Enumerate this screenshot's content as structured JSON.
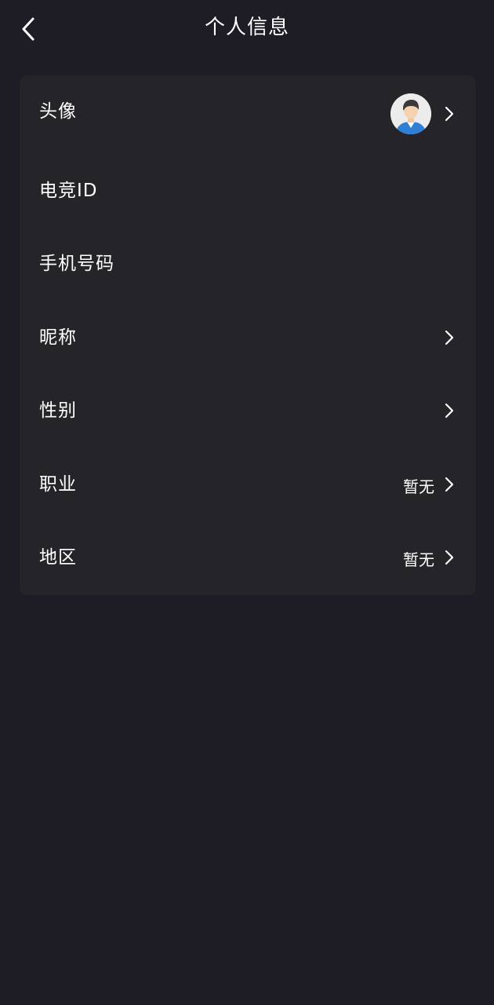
{
  "header": {
    "title": "个人信息",
    "back_icon": "chevron-left-icon"
  },
  "colors": {
    "background": "#1e1c24",
    "card": "#252429",
    "text": "#ffffff"
  },
  "profile": {
    "rows": [
      {
        "label": "头像",
        "value": "",
        "has_avatar": true,
        "has_chevron": true
      },
      {
        "label": "电竞ID",
        "value": "",
        "has_avatar": false,
        "has_chevron": false
      },
      {
        "label": "手机号码",
        "value": "",
        "has_avatar": false,
        "has_chevron": false
      },
      {
        "label": "昵称",
        "value": "",
        "has_avatar": false,
        "has_chevron": true
      },
      {
        "label": "性别",
        "value": "",
        "has_avatar": false,
        "has_chevron": true
      },
      {
        "label": "职业",
        "value": "暂无",
        "has_avatar": false,
        "has_chevron": true
      },
      {
        "label": "地区",
        "value": "暂无",
        "has_avatar": false,
        "has_chevron": true
      }
    ]
  }
}
